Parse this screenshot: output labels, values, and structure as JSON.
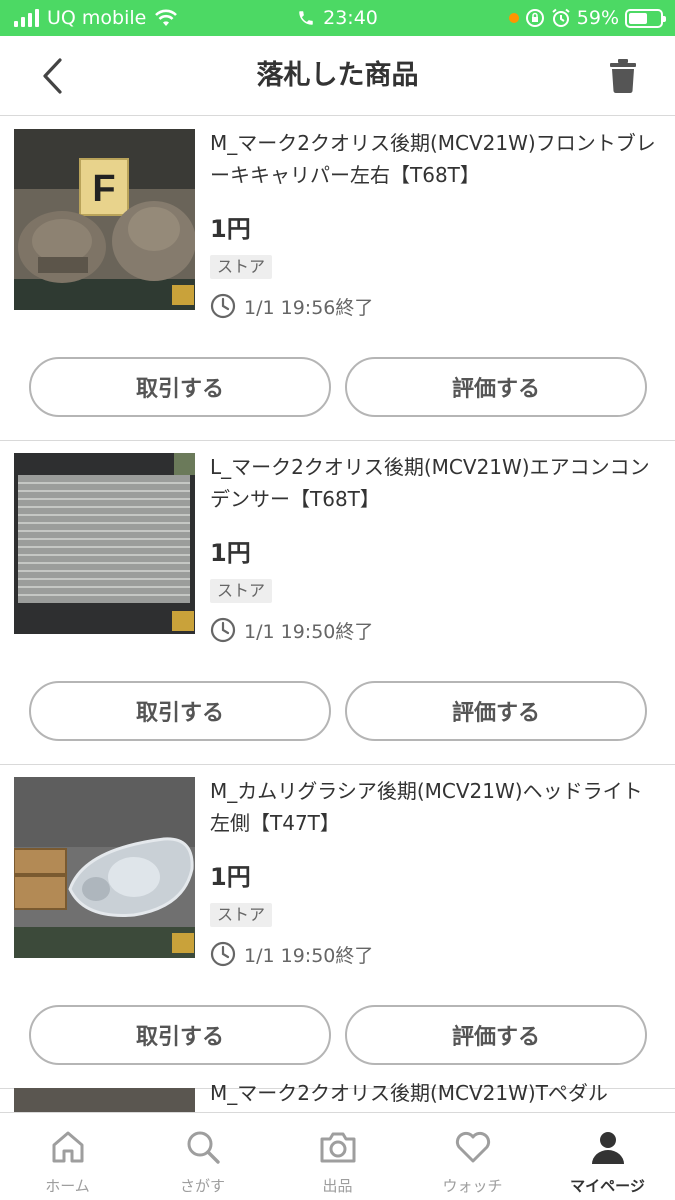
{
  "status_bar": {
    "carrier": "UQ mobile",
    "time": "23:40",
    "battery": "59%",
    "battery_level": 0.59,
    "bg_color": "#4cd964"
  },
  "header": {
    "title": "落札した商品",
    "back_icon": "chevron-left-icon",
    "trash_icon": "trash-icon"
  },
  "items": [
    {
      "title": "M_マーク2クオリス後期(MCV21W)フロントブレーキキャリパー左右【T68T】",
      "price": "1円",
      "badge": "ストア",
      "end_time": "1/1 19:56終了",
      "trade_label": "取引する",
      "rate_label": "評価する",
      "thumb": "brake-caliper-photo",
      "thumb_sign": "F"
    },
    {
      "title": "L_マーク2クオリス後期(MCV21W)エアコンコンデンサー【T68T】",
      "price": "1円",
      "badge": "ストア",
      "end_time": "1/1 19:50終了",
      "trade_label": "取引する",
      "rate_label": "評価する",
      "thumb": "ac-condenser-photo"
    },
    {
      "title": "M_カムリグラシア後期(MCV21W)ヘッドライト左側【T47T】",
      "price": "1円",
      "badge": "ストア",
      "end_time": "1/1 19:50終了",
      "trade_label": "取引する",
      "rate_label": "評価する",
      "thumb": "headlight-photo"
    },
    {
      "title": "M_マーク2クオリス後期(MCV21W)Tペダル",
      "thumb": "partial-photo"
    }
  ],
  "tabs": [
    {
      "label": "ホーム",
      "icon": "home-icon",
      "active": false
    },
    {
      "label": "さがす",
      "icon": "search-icon",
      "active": false
    },
    {
      "label": "出品",
      "icon": "camera-icon",
      "active": false
    },
    {
      "label": "ウォッチ",
      "icon": "heart-icon",
      "active": false
    },
    {
      "label": "マイページ",
      "icon": "person-icon",
      "active": true
    }
  ],
  "colors": {
    "accent_green": "#4cd964",
    "text": "#333333",
    "muted": "#666666",
    "border": "#d9d9d9"
  }
}
